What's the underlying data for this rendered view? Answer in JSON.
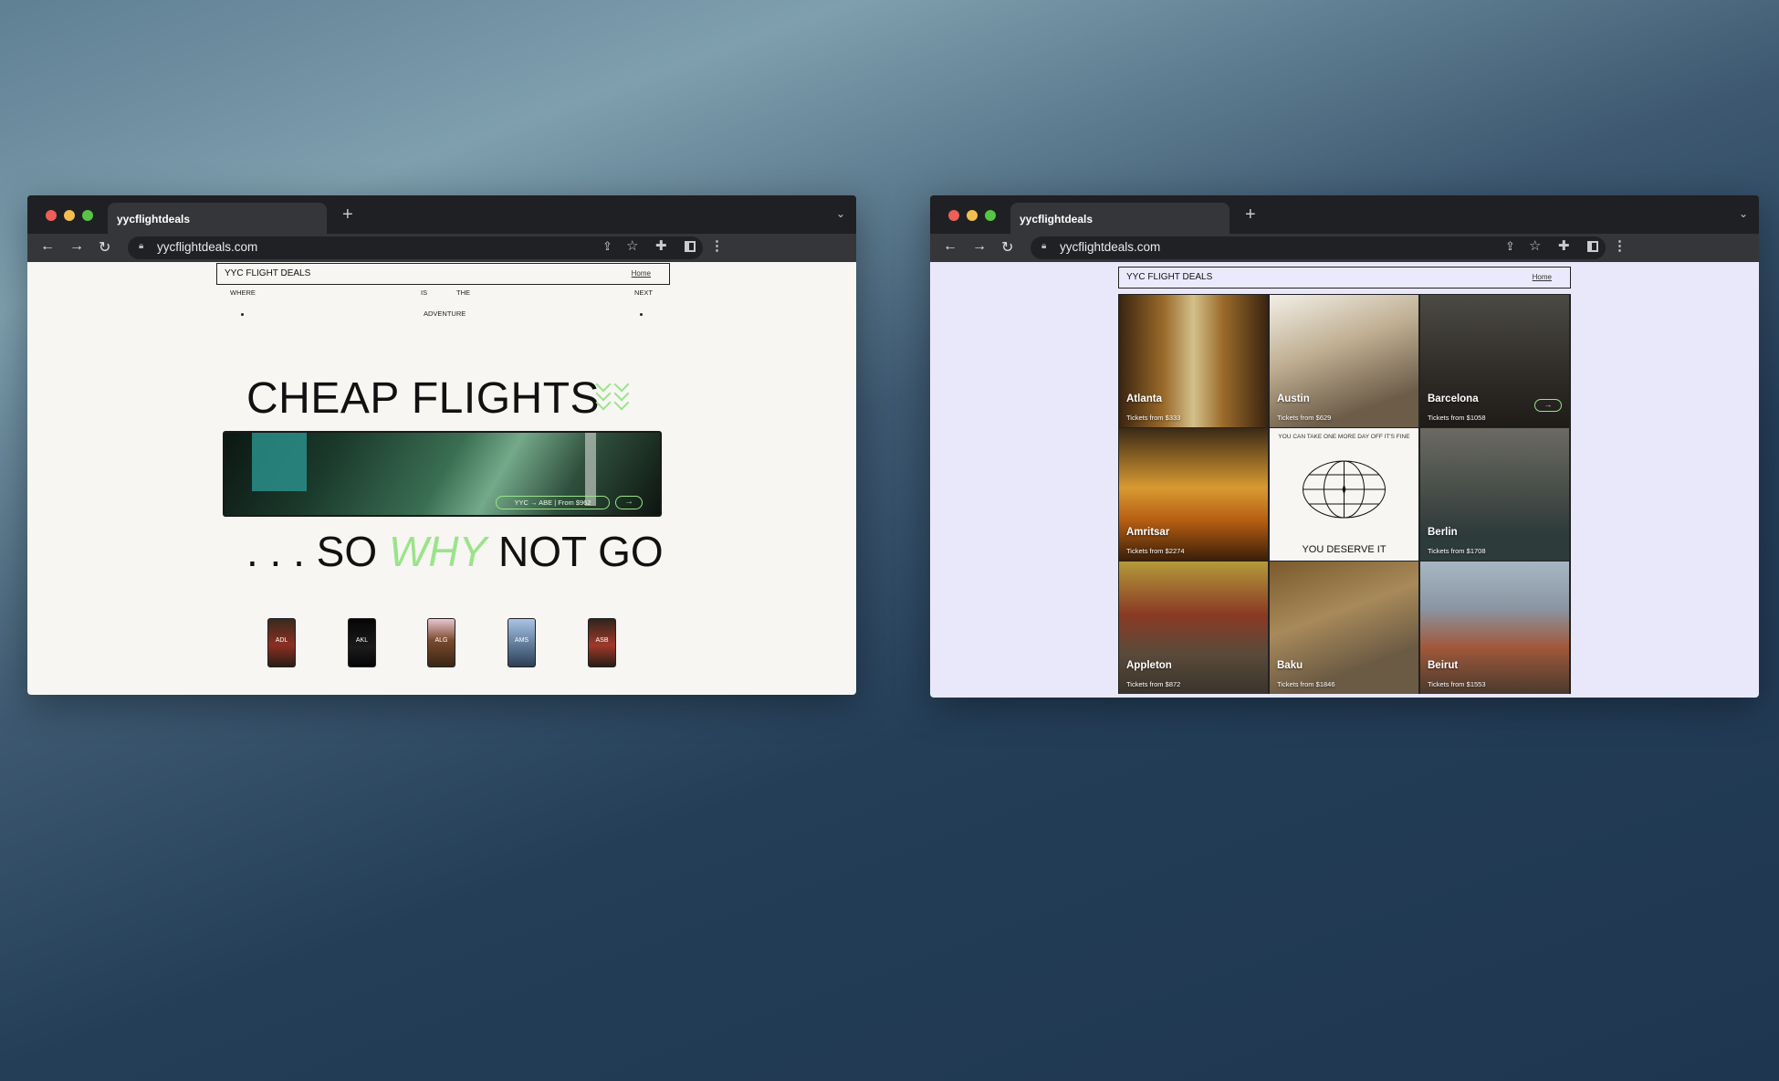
{
  "browser": {
    "tab_title": "yycflightdeals",
    "new_tab": "+",
    "url": "yycflightdeals.com"
  },
  "left_page": {
    "site_title": "YYC FLIGHT DEALS",
    "home_link": "Home",
    "nav_words": [
      "WHERE",
      "IS",
      "THE",
      "NEXT",
      "ADVENTURE"
    ],
    "hero_title": "CHEAP FLIGHTS",
    "banner_route": "YYC → ABE | From $962",
    "banner_arrow": "→",
    "why_prefix": ". . . SO",
    "why_word": "WHY",
    "why_suffix": "NOT GO",
    "thumbnails": [
      "ADL",
      "AKL",
      "ALG",
      "AMS",
      "ASB"
    ]
  },
  "right_page": {
    "site_title": "YYC FLIGHT DEALS",
    "home_link": "Home",
    "destinations": [
      {
        "city": "Atlanta",
        "price": "Tickets from $333"
      },
      {
        "city": "Austin",
        "price": "Tickets from $629"
      },
      {
        "city": "Barcelona",
        "price": "Tickets from $1058"
      },
      {
        "city": "Amritsar",
        "price": "Tickets from $2274"
      },
      {
        "city": "Berlin",
        "price": "Tickets from $1708"
      },
      {
        "city": "Appleton",
        "price": "Tickets from $872"
      },
      {
        "city": "Baku",
        "price": "Tickets from $1846"
      },
      {
        "city": "Beirut",
        "price": "Tickets from $1553"
      }
    ],
    "promo_small": "YOU CAN TAKE ONE MORE DAY OFF IT'S FINE",
    "promo_big": "YOU DESERVE IT",
    "card_arrow": "→"
  }
}
